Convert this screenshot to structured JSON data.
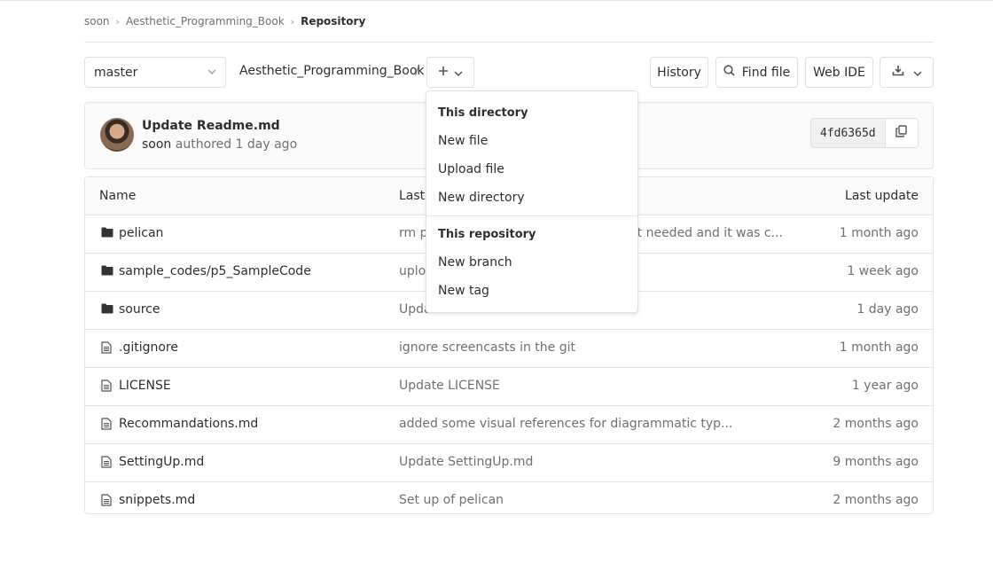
{
  "breadcrumb": {
    "items": [
      "soon",
      "Aesthetic_Programming_Book",
      "Repository"
    ]
  },
  "toolbar": {
    "branch": "master",
    "path_root": "Aesthetic_Programming_Book",
    "path_sep": "/",
    "add_icon": "plus-icon",
    "history_label": "History",
    "find_file_label": "Find file",
    "web_ide_label": "Web IDE",
    "download_icon": "download-icon"
  },
  "commit": {
    "title": "Update Readme.md",
    "author": "soon",
    "meta": "authored 1 day ago",
    "sha": "4fd6365d"
  },
  "tree": {
    "headers": {
      "name": "Name",
      "last_commit": "Last commit",
      "last_update": "Last update"
    },
    "rows": [
      {
        "type": "folder",
        "name": "pelican",
        "message": "rm pelican output folder which was not needed and it was c...",
        "time": "1 month ago"
      },
      {
        "type": "folder",
        "name": "sample_codes/p5_SampleCode",
        "message": "upload sample code",
        "time": "1 week ago"
      },
      {
        "type": "folder",
        "name": "source",
        "message": "Update",
        "time": "1 day ago"
      },
      {
        "type": "file",
        "name": ".gitignore",
        "message": "ignore screencasts in the git",
        "time": "1 month ago"
      },
      {
        "type": "file",
        "name": "LICENSE",
        "message": "Update LICENSE",
        "time": "1 year ago"
      },
      {
        "type": "file",
        "name": "Recommandations.md",
        "message": "added some visual references for diagrammatic typ...",
        "time": "2 months ago"
      },
      {
        "type": "file",
        "name": "SettingUp.md",
        "message": "Update SettingUp.md",
        "time": "9 months ago"
      },
      {
        "type": "file",
        "name": "snippets.md",
        "message": "Set up of pelican",
        "time": "2 months ago"
      }
    ]
  },
  "dropdown": {
    "section1": "This directory",
    "new_file": "New file",
    "upload_file": "Upload file",
    "new_directory": "New directory",
    "section2": "This repository",
    "new_branch": "New branch",
    "new_tag": "New tag"
  },
  "colors": {
    "text": "#2e2e2e",
    "muted": "#707070",
    "border": "#e5e5e5"
  }
}
